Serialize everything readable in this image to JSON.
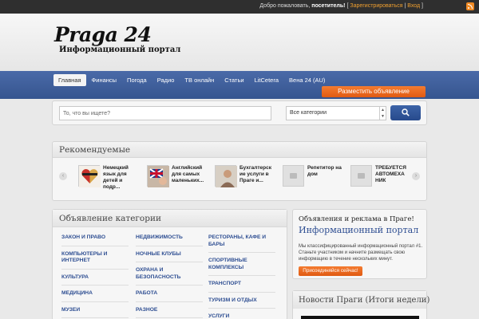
{
  "topbar": {
    "welcome_prefix": "Добро пожаловать,",
    "visitor": "посетитель!",
    "register": "Зарегистрироваться",
    "login": "Вход"
  },
  "header": {
    "logo_title": "Praga 24",
    "logo_subtitle": "Информационный портал"
  },
  "nav": {
    "items": [
      "Главная",
      "Финансы",
      "Погода",
      "Радио",
      "ТВ онлайн",
      "Статьи",
      "LitCetera",
      "Вена 24 (AU)"
    ],
    "post_ad": "Разместить объявление"
  },
  "search": {
    "placeholder": "То, что вы ищете?",
    "category_value": "Все категории"
  },
  "featured": {
    "title": "Рекомендуемые",
    "items": [
      {
        "text": "Немецкий язык для детей и подр..."
      },
      {
        "text": "Английский для самых маленьких..."
      },
      {
        "text": "Бухгалтерск ие услуги в Праге и..."
      },
      {
        "text": "Репетитор на дом"
      },
      {
        "text": "ТРЕБУЕТСЯ АВТОМЕХА НИК"
      }
    ]
  },
  "categories": {
    "title": "Объявление категории",
    "col1": [
      "ЗАКОН И ПРАВО",
      "КОМПЬЮТЕРЫ И ИНТЕРНЕТ",
      "КУЛЬТУРА",
      "МЕДИЦИНА",
      "МУЗЕИ"
    ],
    "col2": [
      "НЕДВИЖИМОСТЬ",
      "НОЧНЫЕ КЛУБЫ",
      "ОХРАНА И БЕЗОПАСНОСТЬ",
      "РАБОТА",
      "РАЗНОЕ"
    ],
    "col3": [
      "РЕСТОРАНЫ, КАФЕ И БАРЫ",
      "СПОРТИВНЫЕ КОМПЛЕКСЫ",
      "ТРАНСПОРТ",
      "ТУРИЗМ И ОТДЫХ",
      "УСЛУГИ"
    ]
  },
  "sidebar": {
    "promo_title": "Объявления и реклама в Праге!",
    "promo_subtitle": "Информационный портал",
    "promo_text": "Мы классифицированный информационный портал #1. Станьте участником и начните размещать свою информацию в течение нескольких минут.",
    "join_button": "Присоединяйся сейчас!",
    "news_title": "Новости Праги (Итоги недели)"
  }
}
